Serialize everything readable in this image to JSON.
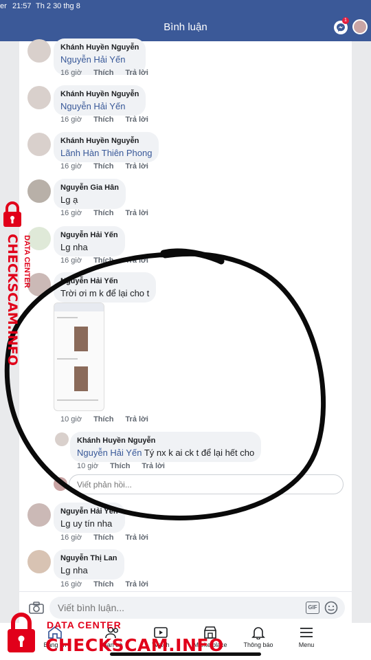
{
  "status_bar": {
    "carrier": "er",
    "time": "21:57",
    "date": "Th 2 30 thg 8"
  },
  "header": {
    "title": "Bình luận",
    "messenger_badge": "1"
  },
  "comments": [
    {
      "author": "Khánh Huyền Nguyễn",
      "mention": "Nguyễn Hải Yến",
      "text": "",
      "time": "16 giờ",
      "like": "Thích",
      "reply": "Trả lời"
    },
    {
      "author": "Khánh Huyền Nguyễn",
      "mention": "Nguyễn Hải Yến",
      "text": "",
      "time": "16 giờ",
      "like": "Thích",
      "reply": "Trả lời"
    },
    {
      "author": "Khánh Huyền Nguyễn",
      "mention": "Lãnh Hàn Thiên Phong",
      "text": "",
      "time": "16 giờ",
      "like": "Thích",
      "reply": "Trả lời"
    },
    {
      "author": "Nguyễn Gia Hân",
      "mention": "",
      "text": "Lg ạ",
      "time": "16 giờ",
      "like": "Thích",
      "reply": "Trả lời"
    },
    {
      "author": "Nguyễn Hải Yến",
      "mention": "",
      "text": "Lg nha",
      "time": "16 giờ",
      "like": "Thích",
      "reply": "Trả lời"
    },
    {
      "author": "Nguyễn Hải Yến",
      "mention": "",
      "text": "Trời ơi m k để lại cho t",
      "time": "10 giờ",
      "like": "Thích",
      "reply": "Trả lời"
    },
    {
      "author": "Khánh Huyền Nguyễn",
      "mention": "Nguyễn Hải Yến",
      "text": " Tý nx k ai ck t để lại hết cho",
      "time": "10 giờ",
      "like": "Thích",
      "reply": "Trả lời"
    },
    {
      "author": "Nguyễn Hải Yến",
      "mention": "",
      "text": "Lg uy tín nha",
      "time": "16 giờ",
      "like": "Thích",
      "reply": "Trả lời"
    },
    {
      "author": "Nguyễn Thị Lan",
      "mention": "",
      "text": "Lg nha",
      "time": "16 giờ",
      "like": "Thích",
      "reply": "Trả lời"
    }
  ],
  "reply_box": {
    "placeholder": "Viết phản hồi..."
  },
  "composer": {
    "placeholder": "Viết bình luận...",
    "gif_label": "GIF"
  },
  "bottom_nav": [
    {
      "label": "Bảng tin",
      "icon": "home-icon"
    },
    {
      "label": "Bạn bè",
      "icon": "friends-icon"
    },
    {
      "label": "Watch",
      "icon": "video-icon"
    },
    {
      "label": "Marketplace",
      "icon": "marketplace-icon"
    },
    {
      "label": "Thông báo",
      "icon": "bell-icon"
    },
    {
      "label": "Menu",
      "icon": "menu-icon"
    }
  ],
  "watermark": {
    "top_line": "DATA CENTER",
    "big_line": "CHECKSCAM.INFO"
  },
  "colors": {
    "brand": "#3b5998",
    "watermark_red": "#e1001a",
    "mention": "#385898"
  }
}
